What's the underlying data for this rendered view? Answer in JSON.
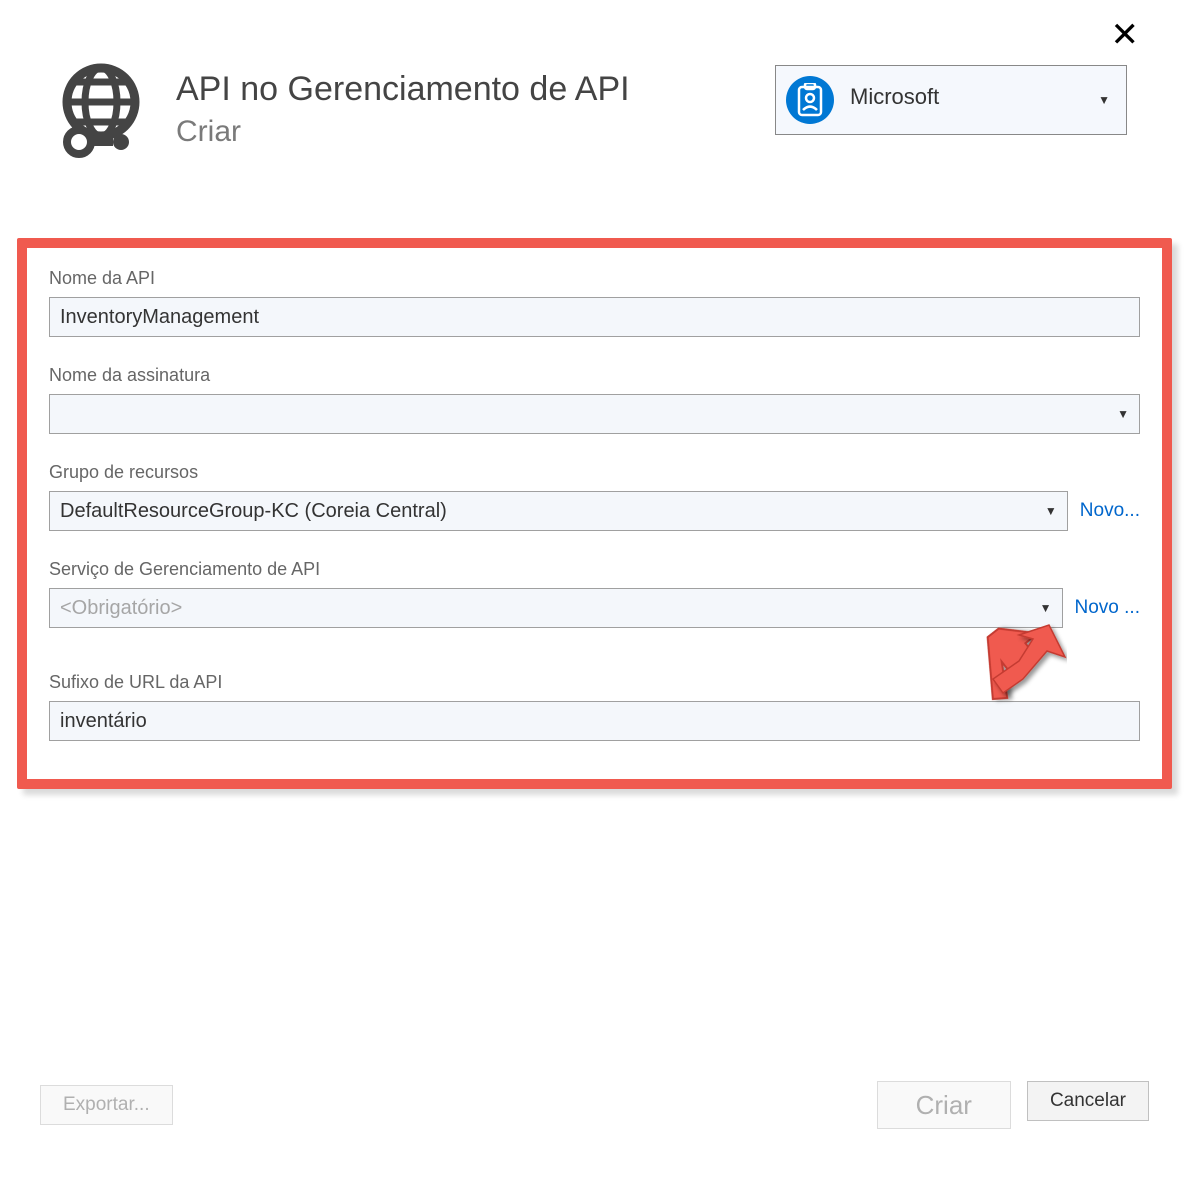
{
  "header": {
    "title": "API no Gerenciamento de API",
    "subtitle": "Criar"
  },
  "account": {
    "name": "Microsoft"
  },
  "form": {
    "apiName": {
      "label": "Nome da API",
      "value": "InventoryManagement"
    },
    "subscription": {
      "label": "Nome da assinatura",
      "value": ""
    },
    "resourceGroup": {
      "label": "Grupo de recursos",
      "value": "DefaultResourceGroup-KC (Coreia Central)",
      "newLink": "Novo..."
    },
    "apimService": {
      "label": "Serviço de Gerenciamento de API",
      "placeholder": "<Obrigatório>",
      "newLink": "Novo ..."
    },
    "urlSuffix": {
      "label": "Sufixo de URL da API",
      "value": "inventário"
    }
  },
  "footer": {
    "export": "Exportar...",
    "create": "Criar",
    "cancel": "Cancelar"
  }
}
